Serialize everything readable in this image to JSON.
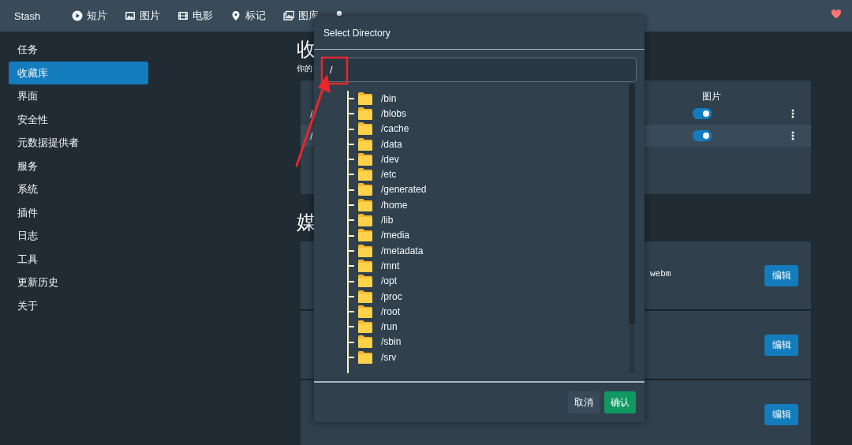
{
  "app": {
    "brand": "Stash"
  },
  "nav": [
    {
      "label": "短片"
    },
    {
      "label": "图片"
    },
    {
      "label": "电影"
    },
    {
      "label": "标记"
    },
    {
      "label": "图库"
    }
  ],
  "sidebar": {
    "items": [
      {
        "label": "任务",
        "selected": false
      },
      {
        "label": "收藏库",
        "selected": true
      },
      {
        "label": "界面",
        "selected": false
      },
      {
        "label": "安全性",
        "selected": false
      },
      {
        "label": "元数据提供者",
        "selected": false
      },
      {
        "label": "服务",
        "selected": false
      },
      {
        "label": "系统",
        "selected": false
      },
      {
        "label": "插件",
        "selected": false
      },
      {
        "label": "日志",
        "selected": false
      },
      {
        "label": "工具",
        "selected": false
      },
      {
        "label": "更新历史",
        "selected": false
      },
      {
        "label": "关于",
        "selected": false
      }
    ]
  },
  "library": {
    "heading": "收",
    "subtitle": "你的",
    "columns": [
      {
        "label": "图片"
      }
    ],
    "rows": [
      {
        "path": "/",
        "images_on": true,
        "selected": false
      },
      {
        "path": "/",
        "images_on": true,
        "selected": true
      }
    ]
  },
  "media": {
    "heading": "媒",
    "cards": [
      {
        "extensions": "webm",
        "button": "编辑"
      },
      {
        "button": "编辑"
      },
      {
        "button": "编辑"
      }
    ]
  },
  "dialog": {
    "title": "Select Directory",
    "path": "/",
    "folders": [
      "/bin",
      "/blobs",
      "/cache",
      "/data",
      "/dev",
      "/etc",
      "/generated",
      "/home",
      "/lib",
      "/media",
      "/metadata",
      "/mnt",
      "/opt",
      "/proc",
      "/root",
      "/run",
      "/sbin",
      "/srv"
    ],
    "buttons": [
      {
        "kind": "cancel",
        "label": "取消"
      },
      {
        "kind": "confirm",
        "label": "确认"
      }
    ]
  }
}
